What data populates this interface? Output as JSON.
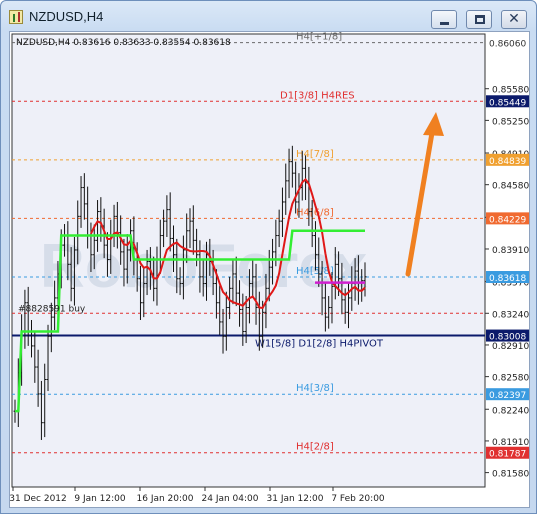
{
  "window": {
    "title": "NZDUSD,H4",
    "minimize_glyph": "minimize-icon",
    "maximize_glyph": "maximize-icon",
    "close_glyph": "✕"
  },
  "chart_data": {
    "type": "candlestick",
    "title": "",
    "header": "NZDUSD,H4  0.83616 0.83633 0.83554 0.83618",
    "watermark": "RoboForex",
    "order_label": "#8828591 buy",
    "price_axis": {
      "ylim": [
        0.8143,
        0.8615
      ],
      "ticks": [
        "0.85580",
        "0.85250",
        "0.84910",
        "0.84580",
        "0.84240",
        "0.83910",
        "0.83570",
        "0.83240",
        "0.82910",
        "0.82580",
        "0.82240",
        "0.81910",
        "0.81580"
      ]
    },
    "time_axis": {
      "labels": [
        "31 Dec 2012",
        "9 Jan 12:00",
        "16 Jan 20:00",
        "24 Jan 04:00",
        "31 Jan 12:00",
        "7 Feb 20:00"
      ]
    },
    "levels": [
      {
        "label": "H4[+1/8]",
        "price": 0.8606,
        "tag": "0.86060",
        "color": "#6a6a6a",
        "tag_bg": "#ffffff",
        "tag_fg": "#333333"
      },
      {
        "label": "D1[3/8] H4RES",
        "price": 0.85449,
        "tag": "0.85449",
        "color": "#e03030",
        "tag_bg": "#0b1a6b",
        "tag_fg": "#ffffff"
      },
      {
        "label": "H4[7/8]",
        "price": 0.84839,
        "tag": "0.84839",
        "color": "#f0a030",
        "tag_bg": "#f0a030",
        "tag_fg": "#ffffff"
      },
      {
        "label": "H4[6/8]",
        "price": 0.84229,
        "tag": "0.84229",
        "color": "#f06a30",
        "tag_bg": "#f06a30",
        "tag_fg": "#ffffff"
      },
      {
        "label": "H4[5/8]",
        "price": 0.83618,
        "tag": "0.83618",
        "color": "#3a9be0",
        "tag_bg": "#3a9be0",
        "tag_fg": "#ffffff"
      },
      {
        "label": "W1[5/8] D1[2/8] H4PIVOT",
        "price": 0.83008,
        "tag": "0.83008",
        "color": "#0b1a6b",
        "tag_bg": "#0b1a6b",
        "tag_fg": "#ffffff"
      },
      {
        "label": "H4[3/8]",
        "price": 0.82397,
        "tag": "0.82397",
        "color": "#3a9be0",
        "tag_bg": "#3a9be0",
        "tag_fg": "#ffffff"
      },
      {
        "label": "H4[2/8]",
        "price": 0.81787,
        "tag": "0.81787",
        "color": "#e03030",
        "tag_bg": "#e03030",
        "tag_fg": "#ffffff"
      }
    ],
    "extra_dashed_level": {
      "price": 0.8324,
      "color": "#e03030"
    },
    "closes": [
      0.8222,
      0.8262,
      0.8305,
      0.8335,
      0.8305,
      0.829,
      0.8268,
      0.824,
      0.821,
      0.8255,
      0.83,
      0.832,
      0.834,
      0.8365,
      0.8395,
      0.8405,
      0.8375,
      0.835,
      0.839,
      0.8425,
      0.8455,
      0.8438,
      0.8405,
      0.8385,
      0.84,
      0.843,
      0.8415,
      0.8395,
      0.838,
      0.8405,
      0.8425,
      0.8408,
      0.8388,
      0.837,
      0.839,
      0.841,
      0.838,
      0.836,
      0.8335,
      0.8355,
      0.8378,
      0.8365,
      0.835,
      0.838,
      0.8405,
      0.842,
      0.8432,
      0.8402,
      0.8385,
      0.836,
      0.8355,
      0.839,
      0.841,
      0.842,
      0.84,
      0.8385,
      0.8362,
      0.8355,
      0.8385,
      0.8378,
      0.8355,
      0.8335,
      0.8315,
      0.83,
      0.833,
      0.835,
      0.8365,
      0.8345,
      0.8328,
      0.8305,
      0.833,
      0.8355,
      0.8362,
      0.833,
      0.83,
      0.8325,
      0.835,
      0.8372,
      0.8388,
      0.8405,
      0.842,
      0.844,
      0.8462,
      0.8482,
      0.847,
      0.844,
      0.8455,
      0.8475,
      0.846,
      0.843,
      0.8405,
      0.8385,
      0.8365,
      0.834,
      0.832,
      0.833,
      0.8352,
      0.8375,
      0.836,
      0.8338,
      0.8325,
      0.834,
      0.8355,
      0.8368,
      0.8348,
      0.8358,
      0.8362
    ],
    "green_line": [
      0.8222,
      0.8222,
      0.8305,
      0.8305,
      0.8305,
      0.8305,
      0.8305,
      0.8305,
      0.8305,
      0.8305,
      0.8305,
      0.8305,
      0.8305,
      0.8305,
      0.8405,
      0.8405,
      0.8405,
      0.8405,
      0.8405,
      0.8405,
      0.8405,
      0.8405,
      0.8405,
      0.8405,
      0.8405,
      0.8405,
      0.8405,
      0.8405,
      0.8405,
      0.8405,
      0.8405,
      0.8405,
      0.8405,
      0.8405,
      0.8405,
      0.8405,
      0.838,
      0.838,
      0.838,
      0.838,
      0.838,
      0.838,
      0.838,
      0.838,
      0.838,
      0.838,
      0.838,
      0.838,
      0.838,
      0.838,
      0.838,
      0.838,
      0.838,
      0.838,
      0.838,
      0.838,
      0.838,
      0.838,
      0.838,
      0.838,
      0.838,
      0.838,
      0.838,
      0.838,
      0.838,
      0.838,
      0.838,
      0.838,
      0.838,
      0.838,
      0.838,
      0.838,
      0.838,
      0.838,
      0.838,
      0.838,
      0.838,
      0.838,
      0.838,
      0.838,
      0.838,
      0.838,
      0.838,
      0.838,
      0.841,
      0.841,
      0.841,
      0.841,
      0.841,
      0.841,
      0.841,
      0.841,
      0.841,
      0.841,
      0.841,
      0.841,
      0.841,
      0.841,
      0.841,
      0.841,
      0.841,
      0.841,
      0.841,
      0.841,
      0.841,
      0.841,
      0.841
    ]
  }
}
